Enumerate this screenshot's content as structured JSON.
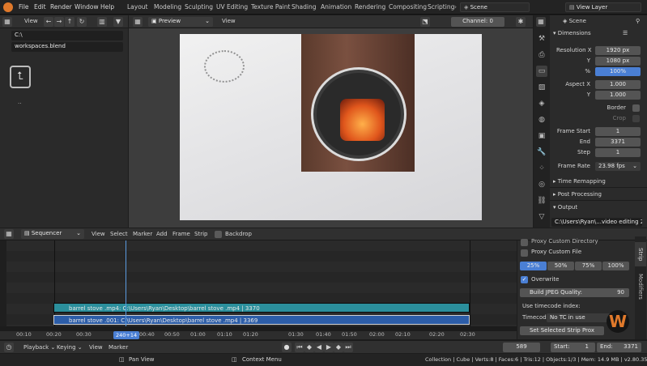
{
  "topbar": {
    "menus": [
      "File",
      "Edit",
      "Render",
      "Window",
      "Help"
    ],
    "workspaces": [
      "Layout",
      "Modeling",
      "Sculpting",
      "UV Editing",
      "Texture Paint",
      "Shading",
      "Animation",
      "Rendering",
      "Compositing",
      "Scripting"
    ],
    "scene_label": "Scene",
    "viewlayer_label": "View Layer"
  },
  "filebrowser": {
    "view_label": "View",
    "path": "C:\\",
    "file": "workspaces.blend",
    "parent_label": ".."
  },
  "preview": {
    "mode": "Preview",
    "view_label": "View",
    "channel_label": "Channel:",
    "channel_value": "0"
  },
  "properties": {
    "scene": "Scene",
    "dimensions_label": "Dimensions",
    "res_x_label": "Resolution X",
    "res_x": "1920 px",
    "res_y_label": "Y",
    "res_y": "1080 px",
    "res_pct_label": "%",
    "res_pct": "100%",
    "aspect_x_label": "Aspect X",
    "aspect_x": "1.000",
    "aspect_y_label": "Y",
    "aspect_y": "1.000",
    "border_label": "Border",
    "crop_label": "Crop",
    "frame_start_label": "Frame Start",
    "frame_start": "1",
    "end_label": "End",
    "end": "3371",
    "step_label": "Step",
    "step": "1",
    "frame_rate_label": "Frame Rate",
    "frame_rate": "23.98 fps",
    "time_remap_label": "Time Remapping",
    "post_label": "Post Processing",
    "output_label": "Output",
    "output_path": "C:\\Users\\Ryan\\...video editing 2"
  },
  "sequencer": {
    "editor": "Sequencer",
    "menus": [
      "View",
      "Select",
      "Marker",
      "Add",
      "Frame",
      "Strip"
    ],
    "backdrop_label": "Backdrop",
    "strip1": "barrel stove .mp4: C:\\Users\\Ryan\\Desktop\\barrel stove .mp4 | 3370",
    "strip2": "barrel stove .001: C:\\Users\\Ryan\\Desktop\\barrel stove .mp4 | 3369",
    "ticks": [
      "00:10",
      "00:20",
      "00:30",
      "00:40",
      "00:50",
      "01:00",
      "01:10",
      "01:20",
      "01:30",
      "01:40",
      "01:50",
      "02:00",
      "02:10",
      "02:20",
      "02:30"
    ],
    "current_time": "0+14",
    "current_time_suffix": "24"
  },
  "strip_sidebar": {
    "proxy_dir_label": "Proxy Custom Directory",
    "proxy_file_label": "Proxy Custom File",
    "pct_options": [
      "25%",
      "50%",
      "75%",
      "100%"
    ],
    "overwrite_label": "Overwrite",
    "jpeg_label": "Build JPEG Quality:",
    "jpeg_value": "90",
    "timecode_label": "Use timecode index:",
    "timecode_short": "Timecod...",
    "timecode_value": "No TC in use",
    "set_selected_label": "Set Selected Strip Prox",
    "tab_strip": "Strip",
    "tab_modifiers": "Modifiers"
  },
  "timeline": {
    "playback": "Playback",
    "keying": "Keying",
    "view": "View",
    "marker": "Marker",
    "frame": "589",
    "start_label": "Start:",
    "start": "1",
    "end_label": "End:",
    "end": "3371"
  },
  "statusbar": {
    "pan": "Pan View",
    "context": "Context Menu",
    "stats": "Collection | Cube | Verts:8 | Faces:6 | Tris:12 | Objects:1/3 | Mem: 14.9 MB | v2.80.35"
  }
}
